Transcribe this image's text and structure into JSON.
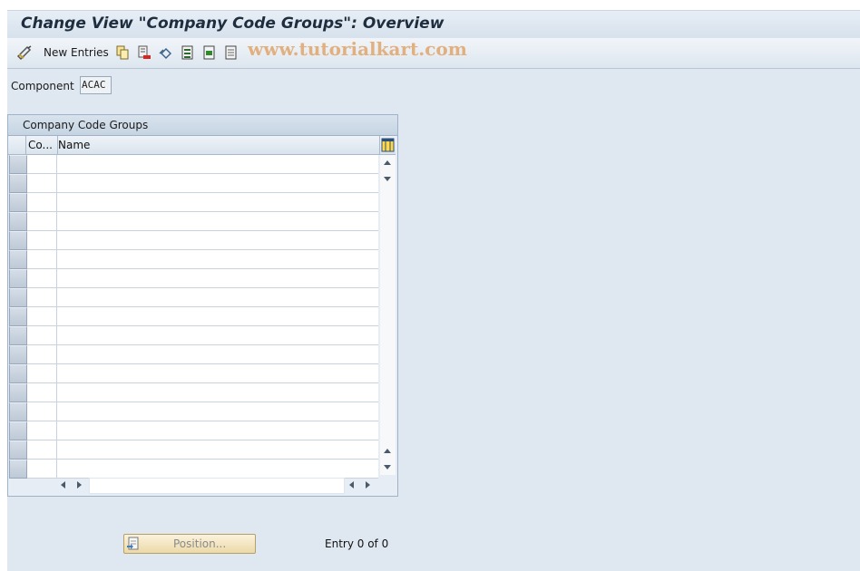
{
  "window": {
    "title": "Change View \"Company Code Groups\": Overview"
  },
  "toolbar": {
    "new_entries_label": "New Entries",
    "icons": [
      "display-change-icon",
      "copy-icon",
      "delete-icon",
      "undo-change-icon",
      "select-all-icon",
      "select-block-icon",
      "deselect-all-icon"
    ],
    "watermark": "www.tutorialkart.com"
  },
  "header": {
    "component_label": "Component",
    "component_value": "ACAC"
  },
  "table": {
    "title": "Company Code Groups",
    "columns": [
      "Co...",
      "Name"
    ],
    "rows": [
      "",
      "",
      "",
      "",
      "",
      "",
      "",
      "",
      "",
      "",
      "",
      "",
      "",
      "",
      "",
      "",
      ""
    ]
  },
  "footer": {
    "position_label": "Position...",
    "entry_text": "Entry 0 of 0"
  },
  "colors": {
    "accent": "#e2b07f",
    "panel": "#dfe8f1",
    "button": "#ecd9a8"
  }
}
